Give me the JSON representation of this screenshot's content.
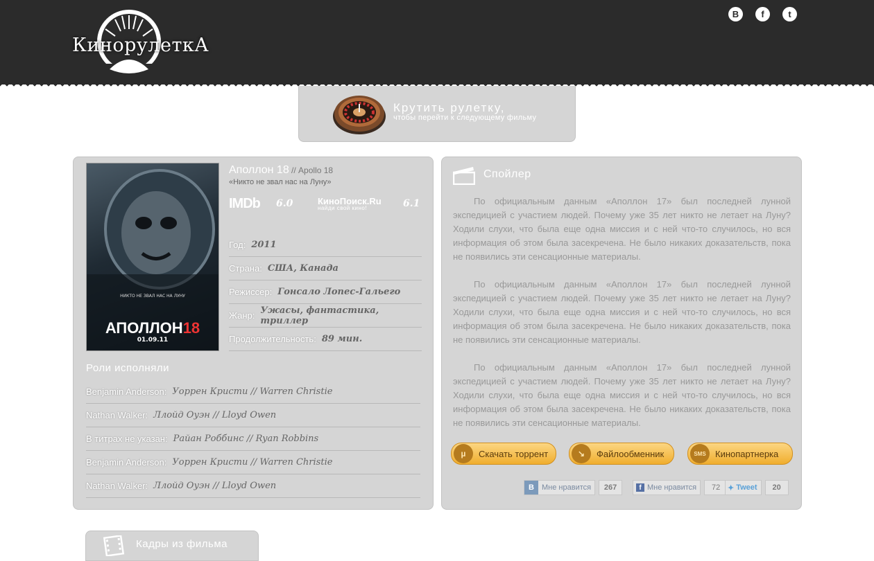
{
  "header": {
    "logo_text": "КинорулеткА",
    "social": [
      {
        "icon": "vk-icon",
        "glyph": "В"
      },
      {
        "icon": "facebook-icon",
        "glyph": "f"
      },
      {
        "icon": "twitter-icon",
        "glyph": "t"
      }
    ]
  },
  "spin": {
    "title": "Крутить рулетку,",
    "subtitle": "чтобы перейти к следующему фильму"
  },
  "movie": {
    "title": "Аполлон 18",
    "original_title": " // Apollo 18",
    "tagline": "«Никто не звал нас на Луну»",
    "poster": {
      "tagline": "НИКТО НЕ ЗВАЛ НАС НА ЛУНУ",
      "title_main": "АПОЛЛОН",
      "title_num": "18",
      "date": "01.09.11"
    },
    "ratings": {
      "imdb_label": "IMDb",
      "imdb_value": "6.0",
      "kp_label": "КиноПоиск.Ru",
      "kp_slogan": "найди свой кино!",
      "kp_value": "6.1"
    },
    "info": [
      {
        "label": "Год:",
        "value": "2011"
      },
      {
        "label": "Страна:",
        "value": "США, Канада"
      },
      {
        "label": "Режиссер:",
        "value": "Гонсало Лопес-Гальего"
      },
      {
        "label": "Жанр:",
        "value": "Ужасы, фантастика, триллер"
      },
      {
        "label": "Продолжительность:",
        "value": "89 мин."
      }
    ]
  },
  "roles": {
    "heading": "Роли исполняли",
    "items": [
      {
        "role": "Benjamin Anderson:",
        "actor": "Уоррен Кристи // Warren Christie"
      },
      {
        "role": "Nathan Walker:",
        "actor": "Ллойд Оуэн // Lloyd Owen"
      },
      {
        "role": "В титрах не указан:",
        "actor": "Райан Роббинс // Ryan Robbins"
      },
      {
        "role": "Benjamin Anderson:",
        "actor": "Уоррен Кристи // Warren Christie"
      },
      {
        "role": "Nathan Walker:",
        "actor": "Ллойд Оуэн // Lloyd Owen"
      }
    ]
  },
  "spoiler": {
    "heading": "Спойлер",
    "paragraphs": [
      "По официальным данным «Аполлон 17» был последней лунной экспедицией с участием людей. Почему уже 35 лет никто не летает на Луну? Ходили слухи, что была еще одна миссия и с ней что-то случилось, но вся информация об этом была засекречена. Не было никаких доказательств, пока не появились эти сенсационные материалы.",
      "По официальным данным «Аполлон 17» был последней лунной экспедицией с участием людей. Почему уже 35 лет никто не летает на Луну? Ходили слухи, что была еще одна миссия и с ней что-то случилось, но вся информация об этом была засекречена. Не было никаких доказательств, пока не появились эти сенсационные материалы.",
      "По официальным данным «Аполлон 17» был последней лунной экспедицией с участием людей. Почему уже 35 лет никто не летает на Луну? Ходили слухи, что была еще одна миссия и с ней что-то случилось, но вся информация об этом была засекречена. Не было никаких доказательств, пока не появились эти сенсационные материалы."
    ]
  },
  "buttons": {
    "torrent": "Скачать торрент",
    "filehost": "Файлообменник",
    "partner": "Кинопартнерка",
    "partner_icon_text": "SMS"
  },
  "likes": {
    "vk_label": "Мне нравится",
    "vk_count": "267",
    "fb_label": "Мне нравится",
    "fb_count": "72",
    "tw_label": "Tweet",
    "tw_count": "20"
  },
  "frames": {
    "heading": "Кадры из фильма"
  }
}
